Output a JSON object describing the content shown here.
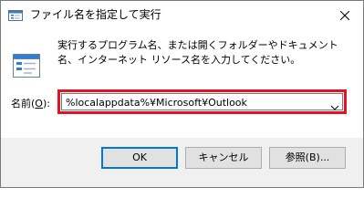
{
  "window": {
    "title": "ファイル名を指定して実行",
    "close_icon": "close-icon"
  },
  "content": {
    "description": "実行するプログラム名、または開くフォルダーやドキュメント名、インターネット リソース名を入力してください。",
    "open_label_prefix": "名前(",
    "open_label_key": "O",
    "open_label_suffix": "):",
    "command_value": "%localappdata%¥Microsoft¥Outlook",
    "highlight_color": "#e81123"
  },
  "buttons": {
    "ok_label": "OK",
    "cancel_label": "キャンセル",
    "browse_label": "参照(B)..."
  },
  "colors": {
    "ok_border": "#0078d7",
    "footer_bg": "#f0f0f0"
  }
}
